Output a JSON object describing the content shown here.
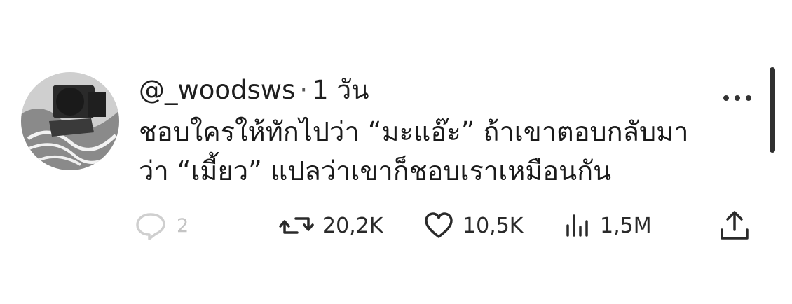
{
  "post": {
    "author_handle": "@_woodsws",
    "separator": "·",
    "time": "1 วัน",
    "text_lines": [
      "ชอบใครให้ทักไปว่า “มะแอ๊ะ” ถ้าเขาตอบกลับมา",
      "ว่า “เมี้ยว” แปลว่าเขาก็ชอบเราเหมือนกัน"
    ],
    "stats": {
      "replies": "2",
      "reposts": "20,2K",
      "likes": "10,5K",
      "views": "1,5M"
    }
  },
  "icons": {
    "more": "more-horizontal-icon",
    "reply": "comment-bubble-icon",
    "repost": "repost-arrows-icon",
    "like": "heart-icon",
    "views": "bar-chart-icon",
    "share": "share-upload-icon"
  },
  "colors": {
    "text": "#1f1f1f",
    "muted": "#c4c4c4",
    "scrollbar": "#303030",
    "background": "#ffffff"
  }
}
